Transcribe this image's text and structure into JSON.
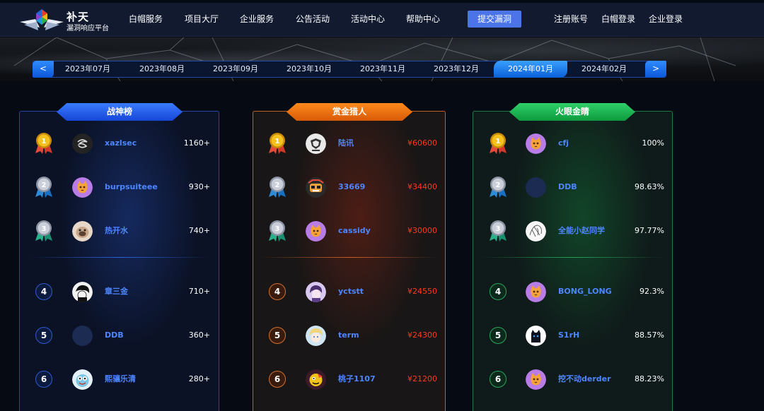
{
  "header": {
    "logo_title": "补天",
    "logo_subtitle": "漏洞响应平台",
    "nav": [
      "白帽服务",
      "项目大厅",
      "企业服务",
      "公告活动",
      "活动中心",
      "帮助中心"
    ],
    "submit_label": "提交漏洞",
    "account": [
      "注册账号",
      "白帽登录",
      "企业登录"
    ]
  },
  "months": {
    "prev_label": "<",
    "next_label": ">",
    "items": [
      "2023年07月",
      "2023年08月",
      "2023年09月",
      "2023年10月",
      "2023年11月",
      "2023年12月",
      "2024年01月",
      "2024年02月"
    ],
    "active_index": 6
  },
  "boards": [
    {
      "title": "战神榜",
      "color": "#2f6dff",
      "rows": [
        {
          "rank": "1",
          "name": "xazlsec",
          "value": "1160+"
        },
        {
          "rank": "2",
          "name": "burpsuiteee",
          "value": "930+"
        },
        {
          "rank": "3",
          "name": "热开水",
          "value": "740+"
        },
        {
          "rank": "4",
          "name": "章三金",
          "value": "710+"
        },
        {
          "rank": "5",
          "name": "DDB",
          "value": "360+"
        },
        {
          "rank": "6",
          "name": "熙骧乐清",
          "value": "280+"
        }
      ]
    },
    {
      "title": "赏金猎人",
      "color": "#f07a14",
      "rows": [
        {
          "rank": "1",
          "name": "陆讯",
          "value": "¥60600"
        },
        {
          "rank": "2",
          "name": "33669",
          "value": "¥34400"
        },
        {
          "rank": "3",
          "name": "cassidy",
          "value": "¥30000"
        },
        {
          "rank": "4",
          "name": "yctstt",
          "value": "¥24550"
        },
        {
          "rank": "5",
          "name": "term",
          "value": "¥24300"
        },
        {
          "rank": "6",
          "name": "桃子1107",
          "value": "¥21200"
        }
      ]
    },
    {
      "title": "火眼金睛",
      "color": "#1fbf59",
      "rows": [
        {
          "rank": "1",
          "name": "cfj",
          "value": "100%"
        },
        {
          "rank": "2",
          "name": "DDB",
          "value": "98.63%"
        },
        {
          "rank": "3",
          "name": "全能小赵同学",
          "value": "97.77%"
        },
        {
          "rank": "4",
          "name": "BONG_LONG",
          "value": "92.3%"
        },
        {
          "rank": "5",
          "name": "S1rH",
          "value": "88.57%"
        },
        {
          "rank": "6",
          "name": "挖不动derder",
          "value": "88.23%"
        }
      ]
    }
  ]
}
